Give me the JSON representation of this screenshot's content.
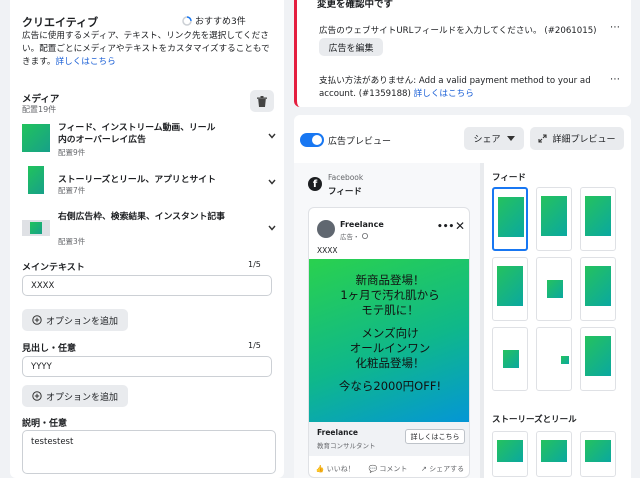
{
  "creative": {
    "title": "クリエイティブ",
    "recommend_label": "おすすめ3件",
    "description": "広告に使用するメディア、テキスト、リンク先を選択してください。配置ごとにメディアやテキストをカスタマイズすることもできます。",
    "learn_more": "詳しくはこちら"
  },
  "media": {
    "title": "メディア",
    "count": "配置19件",
    "groups": [
      {
        "label": "フィード、インストリーム動画、リール内のオーバーレイ広告",
        "count": "配置9件"
      },
      {
        "label": "ストーリーズとリール、アプリとサイト",
        "count": "配置7件"
      },
      {
        "label": "右側広告枠、検索結果、インスタント記事",
        "count": "配置3件"
      }
    ]
  },
  "main_text": {
    "label": "メインテキスト",
    "counter": "1/5",
    "value": "XXXX",
    "add_option": "オプションを追加"
  },
  "headline": {
    "label": "見出し・任意",
    "counter": "1/5",
    "value": "YYYY",
    "add_option": "オプションを追加"
  },
  "description_field": {
    "label": "説明・任意",
    "value": "testestest"
  },
  "errors": {
    "title": "変更を確認中です",
    "items": [
      {
        "text": "広告のウェブサイトURLフィールドを入力してください。 (#2061015)",
        "button": "広告を編集"
      },
      {
        "text": "支払い方法がありません: Add a valid payment method to your ad account. (#1359188)",
        "link": "詳しくはこちら"
      }
    ]
  },
  "preview": {
    "toggle_label": "広告プレビュー",
    "share_label": "シェア",
    "detail_label": "詳細プレビュー",
    "platform": "Facebook",
    "placement": "フィード",
    "post": {
      "page_name": "Freelance",
      "sponsored": "広告・",
      "primary_text": "XXXX",
      "creative_lines": [
        "新商品登場！",
        "1ヶ月で汚れ肌から",
        "モテ肌に！",
        "",
        "メンズ向け",
        "オールインワン",
        "化粧品登場！",
        "",
        "今なら2000円OFF!"
      ],
      "headline": "Freelance",
      "subtitle": "教育コンサルタント",
      "cta": "詳しくはこちら",
      "actions": [
        "いいね！",
        "コメント",
        "シェアする"
      ]
    },
    "side_sections": [
      "フィード",
      "ストーリーズとリール"
    ]
  },
  "colors": {
    "accent": "#1877f2",
    "error": "#e41e3f",
    "creative_green": "#21c35c",
    "creative_teal": "#0aa8a0"
  }
}
